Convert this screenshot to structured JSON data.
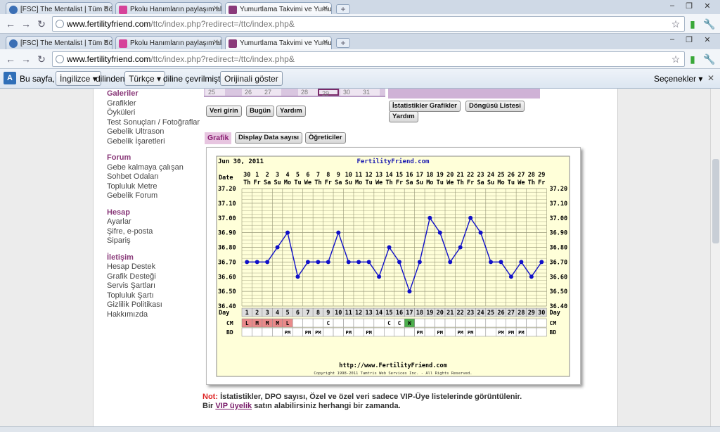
{
  "browser": {
    "tabs": [
      {
        "title": "[FSC] The Mentalist | Tüm Böl",
        "icon_color": "#3b6fb5"
      },
      {
        "title": "Pkolu Hanımların paylaşım alan",
        "icon_color": "#d6439a"
      },
      {
        "title": "Yumurtlama Takvimi ve Yumurt",
        "icon_color": "#8a3a7a"
      }
    ],
    "new_tab": "+",
    "window_controls": [
      "–",
      "❐",
      "✕"
    ],
    "url_host": "www.fertilityfriend.com",
    "url_path": "/ttc/index.php?redirect=/ttc/index.php&"
  },
  "translate_bar": {
    "prefix": "Bu sayfa,",
    "source_lang": "İngilizce",
    "middle": "dilinden",
    "target_lang": "Türkçe",
    "suffix": "diline çevrilmiştir",
    "show_original": "Orijinali göster",
    "options": "Seçenekler"
  },
  "sidebar": {
    "sections": [
      {
        "heading": "Galeriler",
        "items": [
          "Grafikler",
          "Öyküleri",
          "Test Sonuçları / Fotoğraflar",
          "Gebelik Ultrason",
          "Gebelik İşaretleri"
        ]
      },
      {
        "heading": "Forum",
        "items": [
          "Gebe kalmaya çalışan",
          "Sohbet Odaları",
          "Topluluk Metre",
          "Gebelik Forum"
        ]
      },
      {
        "heading": "Hesap",
        "items": [
          "Ayarlar",
          "Şifre, e-posta",
          "Sipariş"
        ]
      },
      {
        "heading": "İletişim",
        "items": [
          "Hesap Destek",
          "Grafik Desteği",
          "Servis Şartları",
          "Topluluk Şartı",
          "Gizlilik Politikası",
          "Hakkımızda"
        ]
      }
    ]
  },
  "calendar": {
    "visible_days": [
      "25",
      "26",
      "27",
      "28",
      "29",
      "30",
      "31"
    ],
    "selected_day": "29"
  },
  "buttons": {
    "data_entry": "Veri girin",
    "today": "Bugün",
    "help": "Yardım",
    "stats_charts": "İstatistikler Grafikler",
    "cycle_list": "Döngüsü Listesi",
    "help2": "Yardım"
  },
  "chart_tabs": {
    "active": "Grafik",
    "display_data": "Display Data sayısı",
    "tutorials": "Öğreticiler"
  },
  "chart_data": {
    "type": "line",
    "date_label": "Jun 30, 2011",
    "site": "FertilityFriend.com",
    "row_label_date": "Date",
    "row_label_day": "Day",
    "row_label_cm": "CM",
    "row_label_bd": "BD",
    "dates": [
      "30",
      "1",
      "2",
      "3",
      "4",
      "5",
      "6",
      "7",
      "8",
      "9",
      "10",
      "11",
      "12",
      "13",
      "14",
      "15",
      "16",
      "17",
      "18",
      "19",
      "20",
      "21",
      "22",
      "23",
      "24",
      "25",
      "26",
      "27",
      "28",
      "29"
    ],
    "weekdays": [
      "Th",
      "Fr",
      "Sa",
      "Su",
      "Mo",
      "Tu",
      "We",
      "Th",
      "Fr",
      "Sa",
      "Su",
      "Mo",
      "Tu",
      "We",
      "Th",
      "Fr",
      "Sa",
      "Su",
      "Mo",
      "Tu",
      "We",
      "Th",
      "Fr",
      "Sa",
      "Su",
      "Mo",
      "Tu",
      "We",
      "Th",
      "Fr"
    ],
    "cycle_days": [
      1,
      2,
      3,
      4,
      5,
      6,
      7,
      8,
      9,
      10,
      11,
      12,
      13,
      14,
      15,
      16,
      17,
      18,
      19,
      20,
      21,
      22,
      23,
      24,
      25,
      26,
      27,
      28,
      29,
      30
    ],
    "temperatures": [
      36.7,
      36.7,
      36.7,
      36.8,
      36.9,
      36.6,
      36.7,
      36.7,
      36.7,
      36.9,
      36.7,
      36.7,
      36.7,
      36.6,
      36.8,
      36.7,
      36.5,
      36.7,
      37.0,
      36.9,
      36.7,
      36.8,
      37.0,
      36.9,
      36.7,
      36.7,
      36.6,
      36.7,
      36.6,
      36.7
    ],
    "y_ticks": [
      "37.20",
      "37.10",
      "37.00",
      "36.90",
      "36.80",
      "36.70",
      "36.60",
      "36.50",
      "36.40"
    ],
    "ylim": [
      36.4,
      37.2
    ],
    "cm": [
      "L",
      "M",
      "M",
      "M",
      "L",
      "",
      "",
      "",
      "C",
      "",
      "",
      "",
      "",
      "",
      "C",
      "C",
      "W",
      "",
      "",
      "",
      "",
      "",
      "",
      "",
      "",
      "",
      "",
      "",
      "",
      ""
    ],
    "cm_colors": {
      "L": "#e98a8a",
      "M": "#e98a8a",
      "W": "#4cae4c",
      "C": ""
    },
    "bd": [
      "",
      "",
      "",
      "",
      "PM",
      "",
      "PM",
      "PM",
      "",
      "",
      "PM",
      "",
      "PM",
      "",
      "",
      "",
      "",
      "PM",
      "",
      "PM",
      "",
      "PM",
      "PM",
      "",
      "",
      "PM",
      "PM",
      "PM",
      "",
      ""
    ],
    "footer_url": "http://www.FertilityFriend.com",
    "copyright": "Copyright 1998-2011 Tamtris Web Services Inc. - All Rights Reserved.",
    "line_color": "#1010c8",
    "grid_bg": "#ffffd9",
    "grid_color": "#9a9a7a"
  },
  "note": {
    "label": "Not:",
    "line1": "İstatistikler, DPO sayısı, Özel ve özel veri sadece VIP-Üye listelerinde görüntülenir.",
    "line2_pre": "Bir",
    "link": "VIP üyelik",
    "line2_post": "satın alabilirsiniz herhangi bir zamanda."
  }
}
